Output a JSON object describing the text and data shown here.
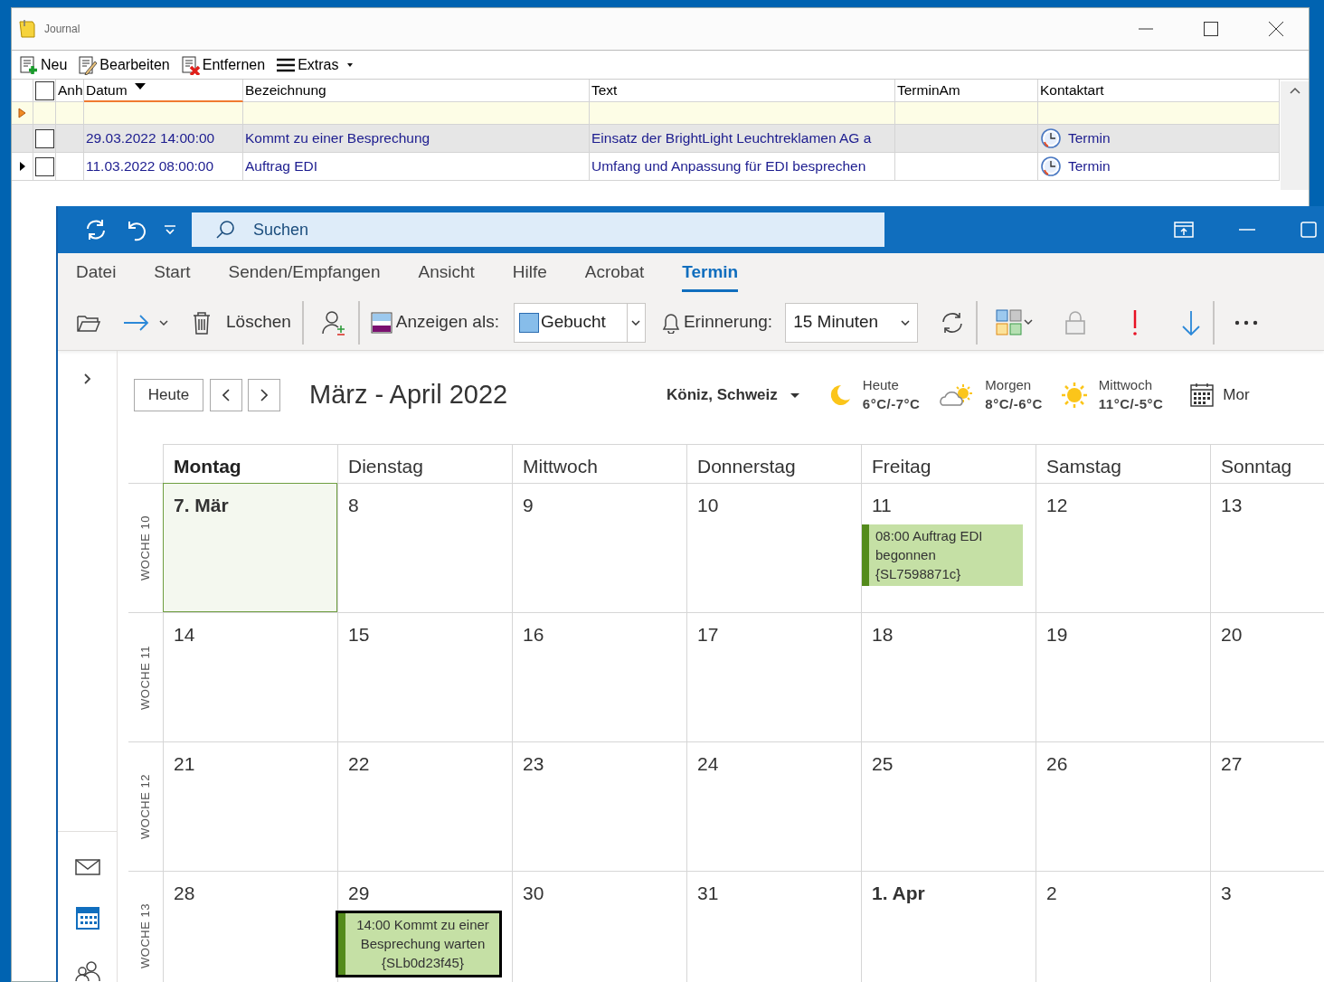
{
  "journal": {
    "title": "Journal",
    "toolbar": [
      {
        "label": "Neu",
        "kind": "new"
      },
      {
        "label": "Bearbeiten",
        "kind": "edit"
      },
      {
        "label": "Entfernen",
        "kind": "delete"
      },
      {
        "label": "Extras",
        "kind": "menu"
      }
    ],
    "header_checkbox": {
      "checked": false
    },
    "columns": [
      {
        "label": "Anh",
        "sorted": false
      },
      {
        "label": "Datum",
        "sorted": true
      },
      {
        "label": "Bezeichnung",
        "sorted": false
      },
      {
        "label": "Text",
        "sorted": false
      },
      {
        "label": "TerminAm",
        "sorted": false
      },
      {
        "label": "Kontaktart",
        "sorted": false
      }
    ],
    "rows": [
      {
        "selected": true,
        "current": false,
        "checked": false,
        "datum": "29.03.2022 14:00:00",
        "bezeichnung": "Kommt zu einer Besprechung",
        "text": "Einsatz der BrightLight Leuchtreklamen AG a",
        "kontaktart": "Termin"
      },
      {
        "selected": false,
        "current": true,
        "checked": false,
        "datum": "11.03.2022 08:00:00",
        "bezeichnung": "Auftrag EDI",
        "text": "Umfang und Anpassung für EDI besprechen",
        "kontaktart": "Termin"
      }
    ]
  },
  "outlook": {
    "search": {
      "placeholder": "Suchen"
    },
    "tabs": [
      {
        "label": "Datei",
        "selected": false
      },
      {
        "label": "Start",
        "selected": false
      },
      {
        "label": "Senden/Empfangen",
        "selected": false
      },
      {
        "label": "Ansicht",
        "selected": false
      },
      {
        "label": "Hilfe",
        "selected": false
      },
      {
        "label": "Acrobat",
        "selected": false
      },
      {
        "label": "Termin",
        "selected": true
      }
    ],
    "ribbon": {
      "delete_label": "Löschen",
      "show_as_label": "Anzeigen als:",
      "show_as": "Gebucht",
      "reminder_label": "Erinnerung:",
      "reminder": "15 Minuten"
    },
    "calendar": {
      "today_button": "Heute",
      "title": "März - April 2022",
      "location": "Köniz, Schweiz",
      "weather": [
        {
          "day": "Heute",
          "temp": "6°C/-7°C",
          "kind": "moon"
        },
        {
          "day": "Morgen",
          "temp": "8°C/-6°C",
          "kind": "cloudy"
        },
        {
          "day": "Mittwoch",
          "temp": "11°C/-5°C",
          "kind": "sun"
        }
      ],
      "view_button": "Mor",
      "weekdays": [
        {
          "label": "Montag",
          "today": true
        },
        {
          "label": "Dienstag",
          "today": false
        },
        {
          "label": "Mittwoch",
          "today": false
        },
        {
          "label": "Donnerstag",
          "today": false
        },
        {
          "label": "Freitag",
          "today": false
        },
        {
          "label": "Samstag",
          "today": false
        },
        {
          "label": "Sonntag",
          "today": false
        }
      ],
      "weeks": [
        {
          "label": "WOCHE 10",
          "days": [
            {
              "label": "7. Mär",
              "today": true,
              "month_start": true
            },
            {
              "label": "8",
              "today": false,
              "month_start": false
            },
            {
              "label": "9",
              "today": false,
              "month_start": false
            },
            {
              "label": "10",
              "today": false,
              "month_start": false
            },
            {
              "label": "11",
              "today": false,
              "month_start": false,
              "events": [
                {
                  "text": "08:00 Auftrag EDI begonnen {SL7598871c}",
                  "selected": false
                }
              ]
            },
            {
              "label": "12",
              "today": false,
              "month_start": false
            },
            {
              "label": "13",
              "today": false,
              "month_start": false
            }
          ]
        },
        {
          "label": "WOCHE 11",
          "days": [
            {
              "label": "14",
              "today": false,
              "month_start": false
            },
            {
              "label": "15",
              "today": false,
              "month_start": false
            },
            {
              "label": "16",
              "today": false,
              "month_start": false
            },
            {
              "label": "17",
              "today": false,
              "month_start": false
            },
            {
              "label": "18",
              "today": false,
              "month_start": false
            },
            {
              "label": "19",
              "today": false,
              "month_start": false
            },
            {
              "label": "20",
              "today": false,
              "month_start": false
            }
          ]
        },
        {
          "label": "WOCHE 12",
          "days": [
            {
              "label": "21",
              "today": false,
              "month_start": false
            },
            {
              "label": "22",
              "today": false,
              "month_start": false
            },
            {
              "label": "23",
              "today": false,
              "month_start": false
            },
            {
              "label": "24",
              "today": false,
              "month_start": false
            },
            {
              "label": "25",
              "today": false,
              "month_start": false
            },
            {
              "label": "26",
              "today": false,
              "month_start": false
            },
            {
              "label": "27",
              "today": false,
              "month_start": false
            }
          ]
        },
        {
          "label": "WOCHE 13",
          "days": [
            {
              "label": "28",
              "today": false,
              "month_start": false
            },
            {
              "label": "29",
              "today": false,
              "month_start": false,
              "events": [
                {
                  "text": "14:00 Kommt zu einer Besprechung warten {SLb0d23f45}",
                  "selected": true
                }
              ]
            },
            {
              "label": "30",
              "today": false,
              "month_start": false
            },
            {
              "label": "31",
              "today": false,
              "month_start": false
            },
            {
              "label": "1. Apr",
              "today": false,
              "month_start": true
            },
            {
              "label": "2",
              "today": false,
              "month_start": false
            },
            {
              "label": "3",
              "today": false,
              "month_start": false
            }
          ]
        }
      ]
    }
  }
}
